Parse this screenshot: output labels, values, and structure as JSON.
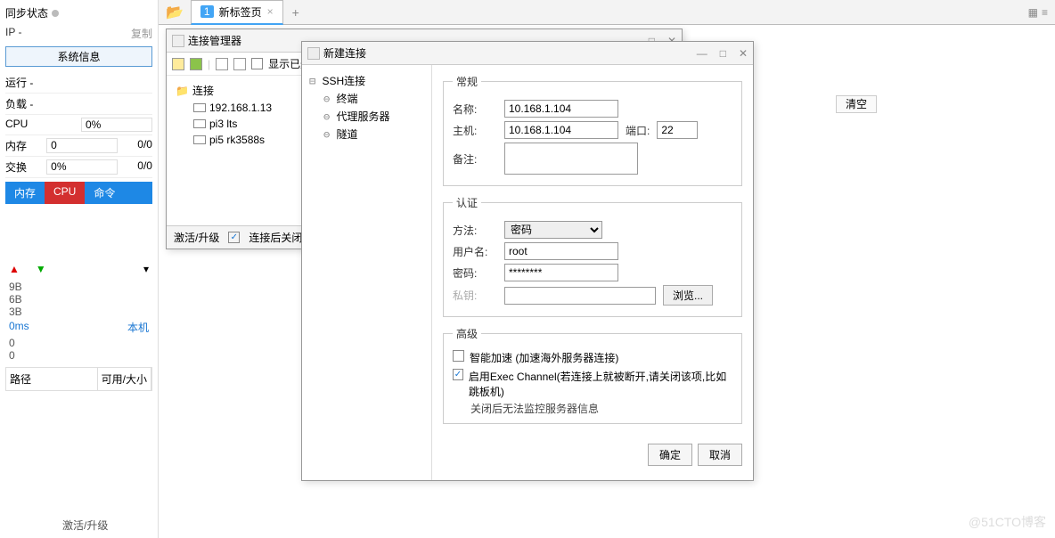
{
  "sidebar": {
    "sync_status": "同步状态",
    "ip_label": "IP -",
    "copy": "复制",
    "sysinfo": "系统信息",
    "rows": {
      "run": "运行 -",
      "load": "负载 -",
      "cpu_label": "CPU",
      "cpu_val": "0%",
      "mem_label": "内存",
      "mem_val": "0",
      "mem_ratio": "0/0",
      "swap_label": "交换",
      "swap_val": "0%",
      "swap_ratio": "0/0"
    },
    "tabs": {
      "mem": "内存",
      "cpu": "CPU",
      "cmd": "命令"
    },
    "chart_y": [
      "9B",
      "6B",
      "3B"
    ],
    "ms": "0ms",
    "local": "本机",
    "zeros": [
      "0",
      "0"
    ],
    "path": "路径",
    "size": "可用/大小",
    "activate": "激活/升级"
  },
  "main": {
    "tab_num": "1",
    "tab_label": "新标签页",
    "clear": "清空"
  },
  "connmgr": {
    "title": "连接管理器",
    "show_deleted": "显示已删",
    "root": "连接",
    "items": [
      "192.168.1.13",
      "pi3 lts",
      "pi5 rk3588s"
    ],
    "activate": "激活/升级",
    "close_after": "连接后关闭"
  },
  "newconn": {
    "title": "新建连接",
    "tree": {
      "root": "SSH连接",
      "items": [
        "终端",
        "代理服务器",
        "隧道"
      ]
    },
    "general": {
      "legend": "常规",
      "name": "名称:",
      "name_val": "10.168.1.104",
      "host": "主机:",
      "host_val": "10.168.1.104",
      "port": "端口:",
      "port_val": "22",
      "note": "备注:"
    },
    "auth": {
      "legend": "认证",
      "method": "方法:",
      "method_val": "密码",
      "user": "用户名:",
      "user_val": "root",
      "pass": "密码:",
      "pass_val": "********",
      "key": "私钥:",
      "browse": "浏览..."
    },
    "adv": {
      "legend": "高级",
      "accel": "智能加速 (加速海外服务器连接)",
      "exec": "启用Exec Channel(若连接上就被断开,请关闭该项,比如跳板机)",
      "note": "关闭后无法监控服务器信息"
    },
    "ok": "确定",
    "cancel": "取消"
  },
  "watermark": "@51CTO博客"
}
